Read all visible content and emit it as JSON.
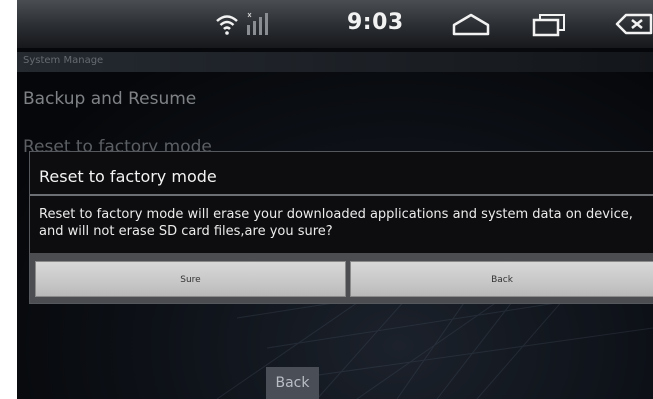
{
  "statusbar": {
    "time": "9:03",
    "icons": [
      "wifi-icon",
      "signal-icon",
      "home-icon",
      "recent-apps-icon",
      "back-icon"
    ]
  },
  "screen": {
    "header": "System Manage",
    "items": [
      {
        "label": "Backup and Resume"
      },
      {
        "label": "Reset to factory mode"
      }
    ],
    "bottom_button": "Back"
  },
  "dialog": {
    "title": "Reset to factory mode",
    "message": "Reset to factory mode will erase your downloaded applications and system data on device, and will not erase SD card files,are you sure?",
    "buttons": {
      "confirm": "Sure",
      "cancel": "Back"
    }
  },
  "colors": {
    "statusbar": "#2a2d31",
    "dialog_bg": "#0d0d0f",
    "button": "#d0d0d0"
  }
}
